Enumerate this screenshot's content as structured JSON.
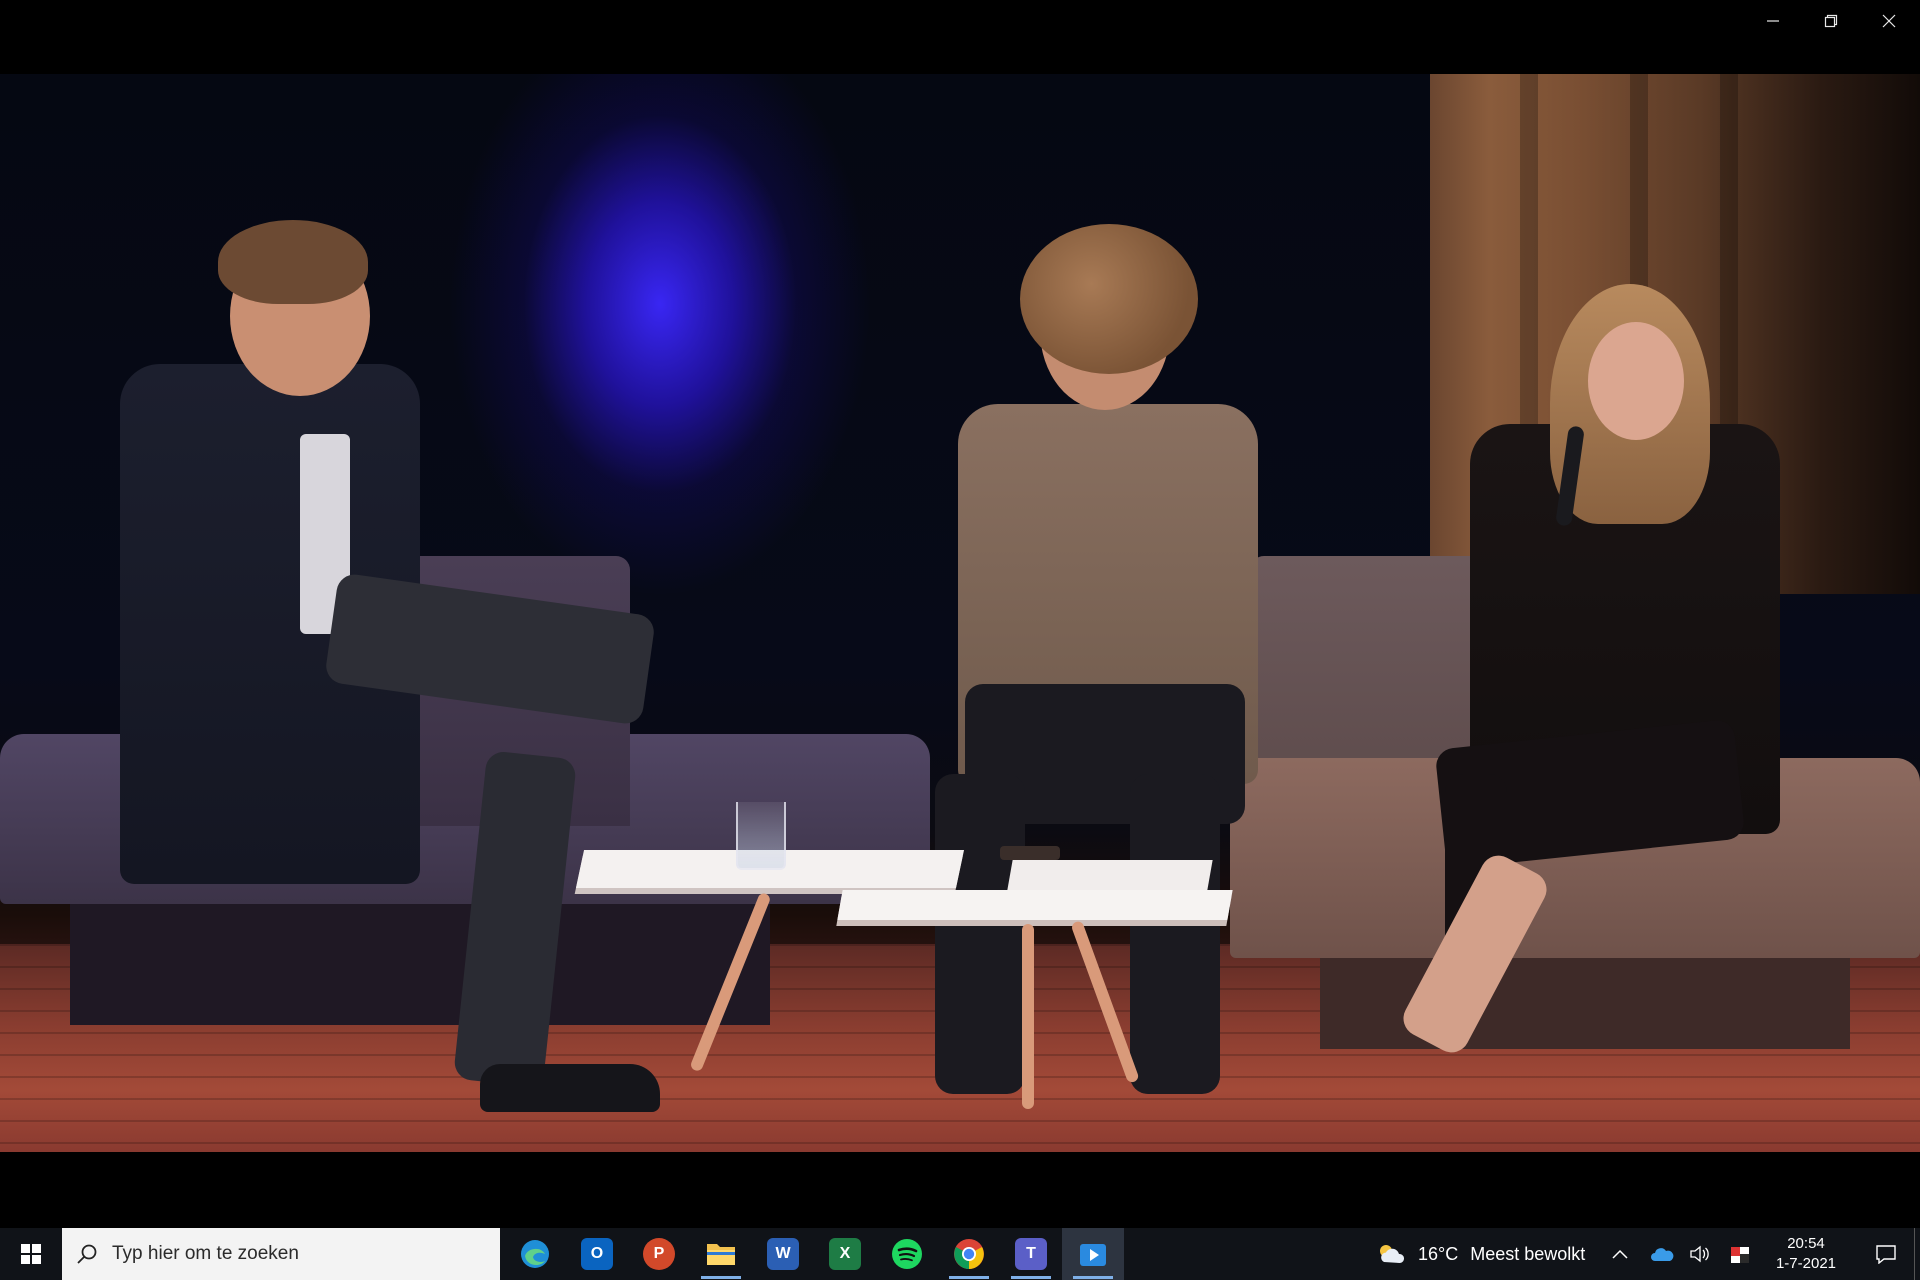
{
  "window": {
    "controls": [
      "minimize",
      "restore",
      "close"
    ]
  },
  "video": {
    "scene": "stage-panel-discussion"
  },
  "taskbar": {
    "search_placeholder": "Typ hier om te zoeken",
    "pinned_apps": [
      {
        "name": "Microsoft Edge",
        "icon": "edge-icon",
        "color": "#1f8fd6"
      },
      {
        "name": "Outlook",
        "icon": "outlook-icon",
        "color": "#0a64c0"
      },
      {
        "name": "PowerPoint",
        "icon": "powerpoint-icon",
        "color": "#d2492a"
      },
      {
        "name": "File Explorer",
        "icon": "folder-icon",
        "color": "#f2c14e"
      },
      {
        "name": "Word",
        "icon": "word-icon",
        "color": "#2b5fb4"
      },
      {
        "name": "Excel",
        "icon": "excel-icon",
        "color": "#1e7c45"
      },
      {
        "name": "Spotify",
        "icon": "spotify-icon",
        "color": "#1ed760"
      },
      {
        "name": "Chrome",
        "icon": "chrome-icon",
        "color": "#e3b341"
      },
      {
        "name": "Teams",
        "icon": "teams-icon",
        "color": "#5b5fc7"
      },
      {
        "name": "Media Player",
        "icon": "media-player-icon",
        "color": "#2a8ae0"
      }
    ],
    "weather": {
      "temperature": "16°C",
      "condition": "Meest bewolkt",
      "icon": "partly-cloudy-icon"
    },
    "clock": {
      "time": "20:54",
      "date": "1-7-2021"
    }
  }
}
